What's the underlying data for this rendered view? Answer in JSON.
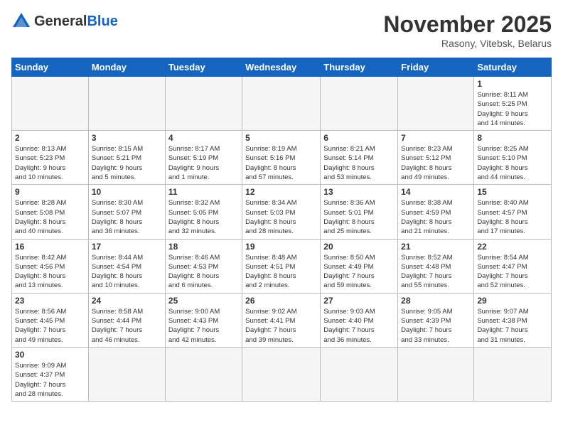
{
  "header": {
    "logo_general": "General",
    "logo_blue": "Blue",
    "month_title": "November 2025",
    "location": "Rasony, Vitebsk, Belarus"
  },
  "weekdays": [
    "Sunday",
    "Monday",
    "Tuesday",
    "Wednesday",
    "Thursday",
    "Friday",
    "Saturday"
  ],
  "weeks": [
    [
      {
        "day": "",
        "info": ""
      },
      {
        "day": "",
        "info": ""
      },
      {
        "day": "",
        "info": ""
      },
      {
        "day": "",
        "info": ""
      },
      {
        "day": "",
        "info": ""
      },
      {
        "day": "",
        "info": ""
      },
      {
        "day": "1",
        "info": "Sunrise: 8:11 AM\nSunset: 5:25 PM\nDaylight: 9 hours\nand 14 minutes."
      }
    ],
    [
      {
        "day": "2",
        "info": "Sunrise: 8:13 AM\nSunset: 5:23 PM\nDaylight: 9 hours\nand 10 minutes."
      },
      {
        "day": "3",
        "info": "Sunrise: 8:15 AM\nSunset: 5:21 PM\nDaylight: 9 hours\nand 5 minutes."
      },
      {
        "day": "4",
        "info": "Sunrise: 8:17 AM\nSunset: 5:19 PM\nDaylight: 9 hours\nand 1 minute."
      },
      {
        "day": "5",
        "info": "Sunrise: 8:19 AM\nSunset: 5:16 PM\nDaylight: 8 hours\nand 57 minutes."
      },
      {
        "day": "6",
        "info": "Sunrise: 8:21 AM\nSunset: 5:14 PM\nDaylight: 8 hours\nand 53 minutes."
      },
      {
        "day": "7",
        "info": "Sunrise: 8:23 AM\nSunset: 5:12 PM\nDaylight: 8 hours\nand 49 minutes."
      },
      {
        "day": "8",
        "info": "Sunrise: 8:25 AM\nSunset: 5:10 PM\nDaylight: 8 hours\nand 44 minutes."
      }
    ],
    [
      {
        "day": "9",
        "info": "Sunrise: 8:28 AM\nSunset: 5:08 PM\nDaylight: 8 hours\nand 40 minutes."
      },
      {
        "day": "10",
        "info": "Sunrise: 8:30 AM\nSunset: 5:07 PM\nDaylight: 8 hours\nand 36 minutes."
      },
      {
        "day": "11",
        "info": "Sunrise: 8:32 AM\nSunset: 5:05 PM\nDaylight: 8 hours\nand 32 minutes."
      },
      {
        "day": "12",
        "info": "Sunrise: 8:34 AM\nSunset: 5:03 PM\nDaylight: 8 hours\nand 28 minutes."
      },
      {
        "day": "13",
        "info": "Sunrise: 8:36 AM\nSunset: 5:01 PM\nDaylight: 8 hours\nand 25 minutes."
      },
      {
        "day": "14",
        "info": "Sunrise: 8:38 AM\nSunset: 4:59 PM\nDaylight: 8 hours\nand 21 minutes."
      },
      {
        "day": "15",
        "info": "Sunrise: 8:40 AM\nSunset: 4:57 PM\nDaylight: 8 hours\nand 17 minutes."
      }
    ],
    [
      {
        "day": "16",
        "info": "Sunrise: 8:42 AM\nSunset: 4:56 PM\nDaylight: 8 hours\nand 13 minutes."
      },
      {
        "day": "17",
        "info": "Sunrise: 8:44 AM\nSunset: 4:54 PM\nDaylight: 8 hours\nand 10 minutes."
      },
      {
        "day": "18",
        "info": "Sunrise: 8:46 AM\nSunset: 4:53 PM\nDaylight: 8 hours\nand 6 minutes."
      },
      {
        "day": "19",
        "info": "Sunrise: 8:48 AM\nSunset: 4:51 PM\nDaylight: 8 hours\nand 2 minutes."
      },
      {
        "day": "20",
        "info": "Sunrise: 8:50 AM\nSunset: 4:49 PM\nDaylight: 7 hours\nand 59 minutes."
      },
      {
        "day": "21",
        "info": "Sunrise: 8:52 AM\nSunset: 4:48 PM\nDaylight: 7 hours\nand 55 minutes."
      },
      {
        "day": "22",
        "info": "Sunrise: 8:54 AM\nSunset: 4:47 PM\nDaylight: 7 hours\nand 52 minutes."
      }
    ],
    [
      {
        "day": "23",
        "info": "Sunrise: 8:56 AM\nSunset: 4:45 PM\nDaylight: 7 hours\nand 49 minutes."
      },
      {
        "day": "24",
        "info": "Sunrise: 8:58 AM\nSunset: 4:44 PM\nDaylight: 7 hours\nand 46 minutes."
      },
      {
        "day": "25",
        "info": "Sunrise: 9:00 AM\nSunset: 4:43 PM\nDaylight: 7 hours\nand 42 minutes."
      },
      {
        "day": "26",
        "info": "Sunrise: 9:02 AM\nSunset: 4:41 PM\nDaylight: 7 hours\nand 39 minutes."
      },
      {
        "day": "27",
        "info": "Sunrise: 9:03 AM\nSunset: 4:40 PM\nDaylight: 7 hours\nand 36 minutes."
      },
      {
        "day": "28",
        "info": "Sunrise: 9:05 AM\nSunset: 4:39 PM\nDaylight: 7 hours\nand 33 minutes."
      },
      {
        "day": "29",
        "info": "Sunrise: 9:07 AM\nSunset: 4:38 PM\nDaylight: 7 hours\nand 31 minutes."
      }
    ],
    [
      {
        "day": "30",
        "info": "Sunrise: 9:09 AM\nSunset: 4:37 PM\nDaylight: 7 hours\nand 28 minutes."
      },
      {
        "day": "",
        "info": ""
      },
      {
        "day": "",
        "info": ""
      },
      {
        "day": "",
        "info": ""
      },
      {
        "day": "",
        "info": ""
      },
      {
        "day": "",
        "info": ""
      },
      {
        "day": "",
        "info": ""
      }
    ]
  ]
}
